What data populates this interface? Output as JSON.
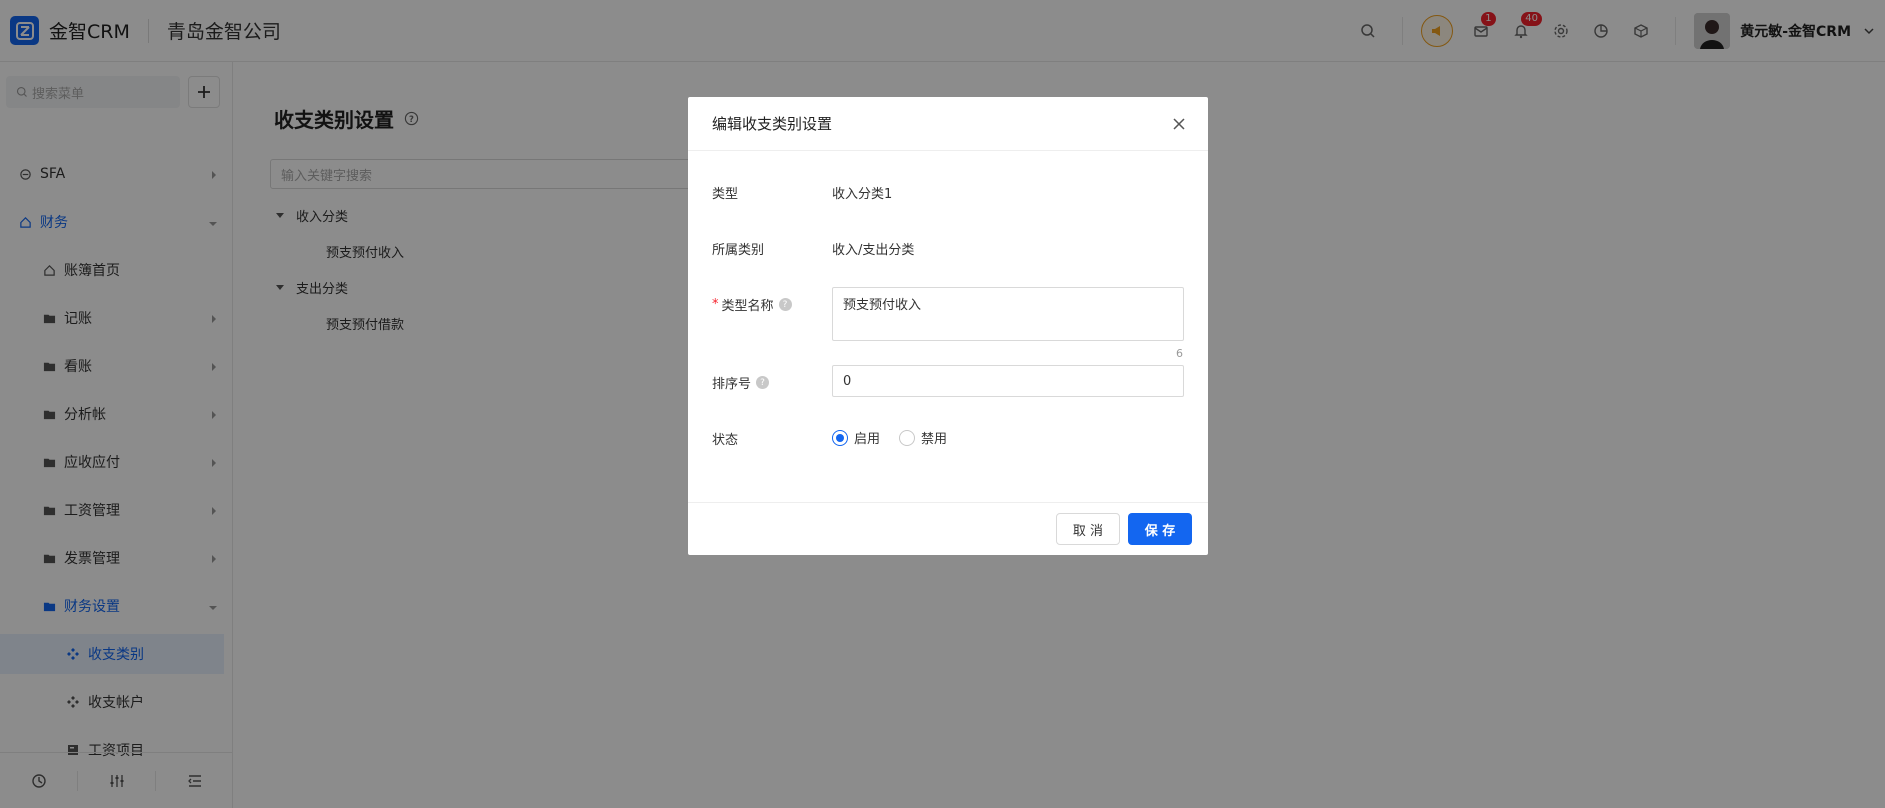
{
  "header": {
    "app_name": "金智CRM",
    "company": "青岛金智公司",
    "notif_badge_1": "1",
    "notif_badge_2": "40",
    "user_name": "黄元敏-金智CRM"
  },
  "sidebar": {
    "search_placeholder": "搜索菜单",
    "items": [
      {
        "label": "SFA"
      },
      {
        "label": "财务"
      },
      {
        "label": "账簿首页"
      },
      {
        "label": "记账"
      },
      {
        "label": "看账"
      },
      {
        "label": "分析帐"
      },
      {
        "label": "应收应付"
      },
      {
        "label": "工资管理"
      },
      {
        "label": "发票管理"
      },
      {
        "label": "财务设置"
      },
      {
        "label": "收支类别"
      },
      {
        "label": "收支帐户"
      },
      {
        "label": "工资项目"
      }
    ]
  },
  "main": {
    "title": "收支类别设置",
    "search_placeholder": "输入关键字搜索",
    "tree": [
      {
        "label": "收入分类",
        "children": [
          "预支预付收入"
        ]
      },
      {
        "label": "支出分类",
        "children": [
          "预支预付借款"
        ]
      }
    ]
  },
  "modal": {
    "title": "编辑收支类别设置",
    "type_label": "类型",
    "type_value": "收入分类1",
    "category_label": "所属类别",
    "category_value": "收入/支出分类",
    "name_label": "类型名称",
    "name_value": "预支预付收入",
    "name_count": "6",
    "sort_label": "排序号",
    "sort_value": "0",
    "status_label": "状态",
    "status_enabled": "启用",
    "status_disabled": "禁用",
    "cancel_label": "取 消",
    "save_label": "保 存"
  },
  "colors": {
    "accent": "#1366f0",
    "badge": "#f5222d"
  }
}
